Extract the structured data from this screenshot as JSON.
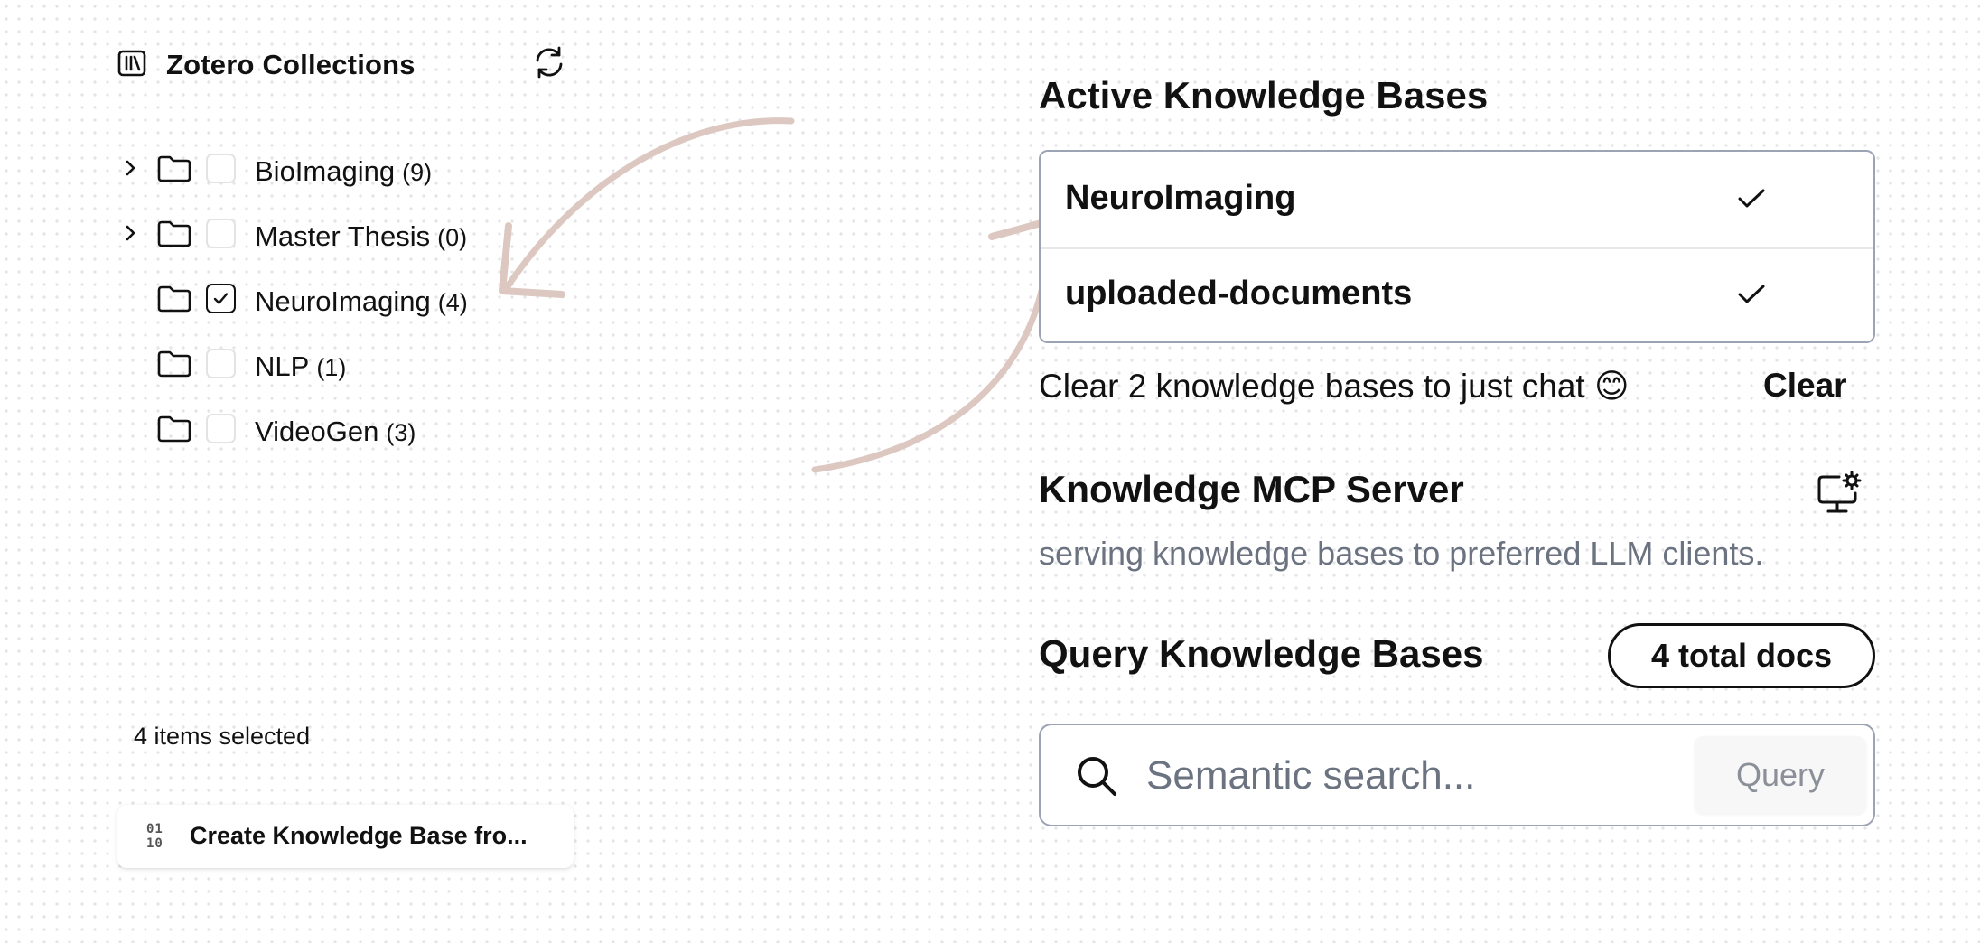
{
  "sidebar": {
    "title": "Zotero Collections",
    "icons": {
      "header": "library-icon",
      "refresh": "refresh-icon"
    },
    "collections": [
      {
        "name": "BioImaging",
        "count": "(9)",
        "expandable": true,
        "checked": false
      },
      {
        "name": "Master Thesis",
        "count": "(0)",
        "expandable": true,
        "checked": false
      },
      {
        "name": "NeuroImaging",
        "count": "(4)",
        "expandable": false,
        "checked": true
      },
      {
        "name": "NLP",
        "count": "(1)",
        "expandable": false,
        "checked": false
      },
      {
        "name": "VideoGen",
        "count": "(3)",
        "expandable": false,
        "checked": false
      }
    ],
    "selected_text": "4 items selected",
    "create_button": {
      "icon_text": "01\n10",
      "label": "Create Knowledge Base fro..."
    }
  },
  "knowledge": {
    "active_title": "Active Knowledge Bases",
    "active_bases": [
      {
        "name": "NeuroImaging",
        "selected": true
      },
      {
        "name": "uploaded-documents",
        "selected": true
      }
    ],
    "clear_text": "Clear 2 knowledge bases to just chat 😊",
    "clear_label": "Clear",
    "mcp_title": "Knowledge MCP Server",
    "mcp_subtitle": "serving knowledge bases to preferred LLM clients.",
    "mcp_icon": "monitor-gear-icon",
    "query_title": "Query Knowledge Bases",
    "total_docs": "4 total docs",
    "search_placeholder": "Semantic search...",
    "query_label": "Query"
  },
  "colors": {
    "arrow": "#dcc8c0",
    "border": "#9ca3b4",
    "muted_text": "#6b7280",
    "text": "#111111"
  }
}
